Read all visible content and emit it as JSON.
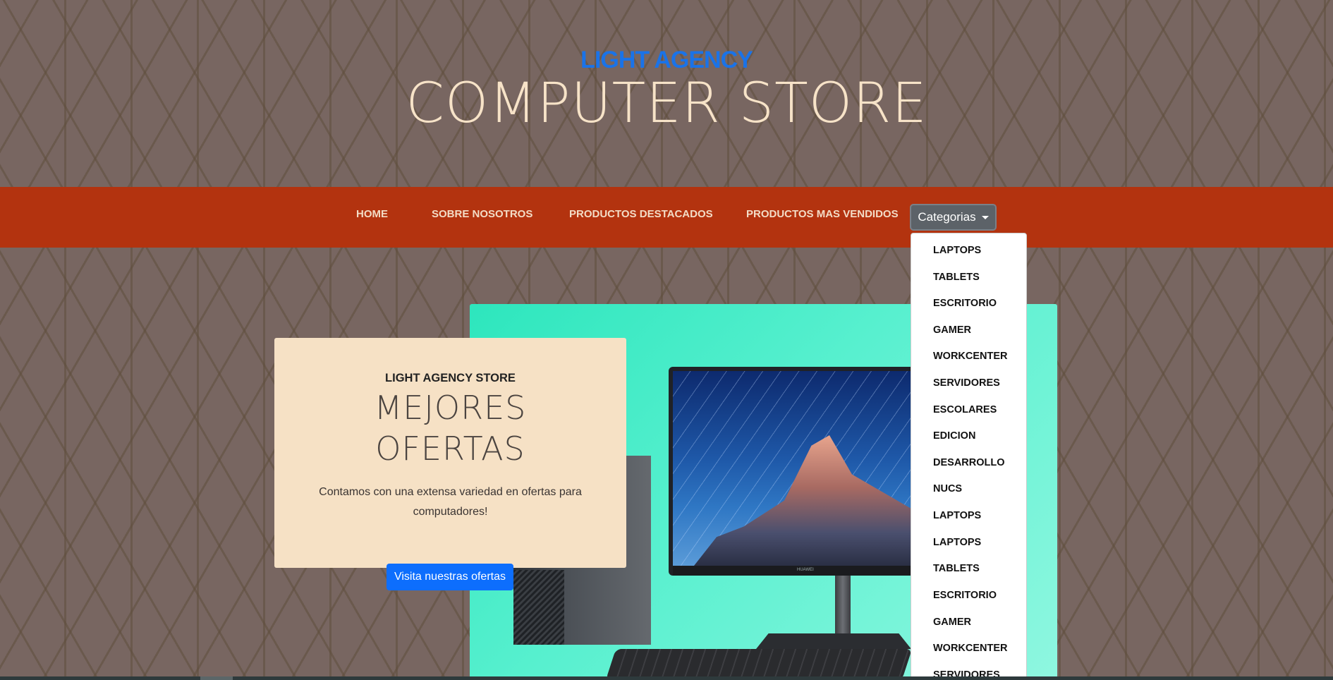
{
  "header": {
    "brand_small": "LIGHT AGENCY",
    "brand_large": "COMPUTER STORE"
  },
  "nav": {
    "items": [
      "HOME",
      "SOBRE NOSOTROS",
      "PRODUCTOS DESTACADOS",
      "PRODUCTOS MAS VENDIDOS"
    ],
    "dropdown_label": "Categorias",
    "dropdown_items": [
      "LAPTOPS",
      "TABLETS",
      "ESCRITORIO",
      "GAMER",
      "WORKCENTER",
      "SERVIDORES",
      "ESCOLARES",
      "EDICION",
      "DESARROLLO",
      "NUCS",
      "LAPTOPS",
      "LAPTOPS",
      "TABLETS",
      "ESCRITORIO",
      "GAMER",
      "WORKCENTER",
      "SERVIDORES"
    ]
  },
  "hero": {
    "monitor_brand": "HUAWEI",
    "card_small": "LIGHT AGENCY STORE",
    "card_large_line1": "MEJORES",
    "card_large_line2": "OFERTAS",
    "card_text": "Contamos con una extensa variedad en ofertas para computadores!",
    "button_label": "Visita nuestras ofertas"
  },
  "colors": {
    "navbar": "#b3330f",
    "brand_accent": "#1a73e8",
    "card": "#f6e1c5",
    "button": "#0d6efd"
  }
}
